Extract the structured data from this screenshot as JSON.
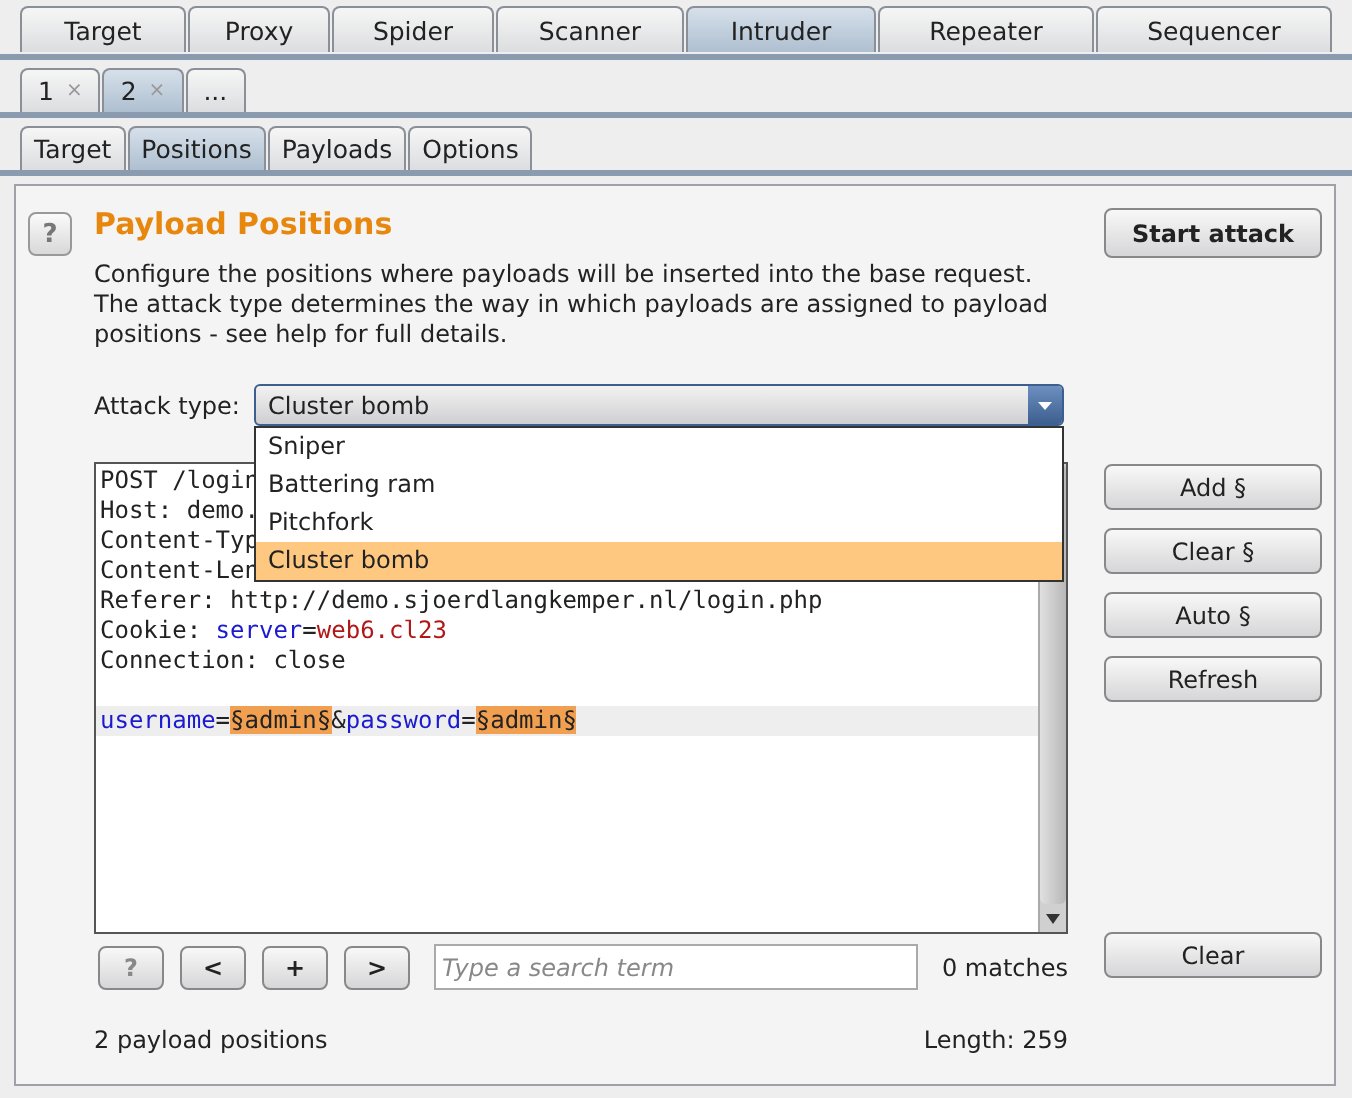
{
  "main_tabs": [
    {
      "label": "Target",
      "selected": false
    },
    {
      "label": "Proxy",
      "selected": false
    },
    {
      "label": "Spider",
      "selected": false
    },
    {
      "label": "Scanner",
      "selected": false
    },
    {
      "label": "Intruder",
      "selected": true
    },
    {
      "label": "Repeater",
      "selected": false
    },
    {
      "label": "Sequencer",
      "selected": false
    }
  ],
  "request_tabs": [
    {
      "label": "1",
      "close": "×",
      "selected": false
    },
    {
      "label": "2",
      "close": "×",
      "selected": true
    },
    {
      "label": "...",
      "selected": false
    }
  ],
  "sub_tabs": [
    {
      "label": "Target",
      "selected": false
    },
    {
      "label": "Positions",
      "selected": true
    },
    {
      "label": "Payloads",
      "selected": false
    },
    {
      "label": "Options",
      "selected": false
    }
  ],
  "panel": {
    "help": "?",
    "title": "Payload Positions",
    "description": "Configure the positions where payloads will be inserted into the base request. The attack type determines the way in which payloads are assigned to payload positions - see help for full details.",
    "start_button": "Start attack",
    "attack_type": {
      "label": "Attack type:",
      "value": "Cluster bomb",
      "expanded": true,
      "options": [
        {
          "label": "Sniper",
          "selected": false
        },
        {
          "label": "Battering ram",
          "selected": false
        },
        {
          "label": "Pitchfork",
          "selected": false
        },
        {
          "label": "Cluster bomb",
          "selected": true
        }
      ]
    },
    "editor": {
      "lines": [
        {
          "current": false,
          "segments": [
            {
              "kind": "plain",
              "text": "POST /login"
            }
          ]
        },
        {
          "current": false,
          "segments": [
            {
              "kind": "plain",
              "text": "Host: demo."
            }
          ]
        },
        {
          "current": false,
          "segments": [
            {
              "kind": "plain",
              "text": "Content-Typ"
            }
          ]
        },
        {
          "current": false,
          "segments": [
            {
              "kind": "plain",
              "text": "Content-Len"
            }
          ]
        },
        {
          "current": false,
          "segments": [
            {
              "kind": "plain",
              "text": "Referer: http://demo.sjoerdlangkemper.nl/login.php"
            }
          ]
        },
        {
          "current": false,
          "segments": [
            {
              "kind": "plain",
              "text": "Cookie: "
            },
            {
              "kind": "name",
              "text": "server"
            },
            {
              "kind": "plain",
              "text": "="
            },
            {
              "kind": "value",
              "text": "web6.cl23"
            }
          ]
        },
        {
          "current": false,
          "segments": [
            {
              "kind": "plain",
              "text": "Connection: close"
            }
          ]
        },
        {
          "current": false
        },
        {
          "current": true,
          "segments": [
            {
              "kind": "name",
              "text": "username"
            },
            {
              "kind": "plain",
              "text": "="
            },
            {
              "kind": "marker",
              "text": "§admin§"
            },
            {
              "kind": "plain",
              "text": "&"
            },
            {
              "kind": "name",
              "text": "password"
            },
            {
              "kind": "plain",
              "text": "="
            },
            {
              "kind": "marker",
              "text": "§admin§"
            }
          ]
        }
      ]
    },
    "side_buttons": [
      "Add §",
      "Clear §",
      "Auto §",
      "Refresh"
    ],
    "search": {
      "buttons": [
        "?",
        "<",
        "+",
        ">"
      ],
      "placeholder": "Type a search term",
      "matches": "0 matches",
      "clear": "Clear"
    },
    "status": "2 payload positions",
    "length": "Length: 259"
  }
}
